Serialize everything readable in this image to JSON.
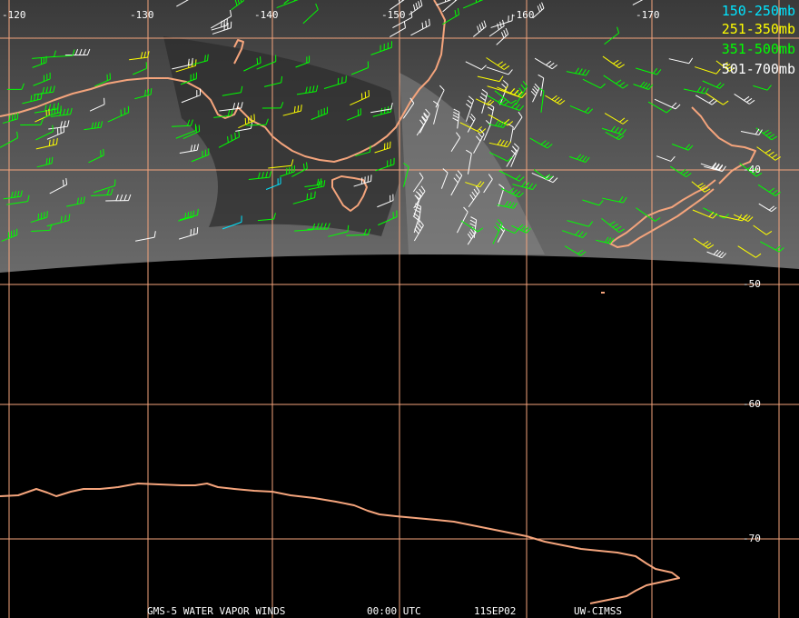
{
  "longitude_labels": [
    "-120",
    "-130",
    "-140",
    "-150",
    "-160",
    "-170"
  ],
  "latitude_labels": [
    "-40",
    "-50",
    "-60",
    "-70"
  ],
  "legend": [
    {
      "label": "150-250mb",
      "color": "#00e5ff"
    },
    {
      "label": "251-350mb",
      "color": "#ffff00"
    },
    {
      "label": "351-500mb",
      "color": "#00ff00"
    },
    {
      "label": "501-700mb",
      "color": "#ffffff"
    }
  ],
  "footer": {
    "product": "GMS-5 WATER VAPOR WINDS",
    "time": "00:00 UTC",
    "date": "11SEP02",
    "source": "UW-CIMSS"
  },
  "colors": {
    "gridline": "#f4a47c",
    "coastline": "#f4a47c",
    "background": "#000000"
  }
}
